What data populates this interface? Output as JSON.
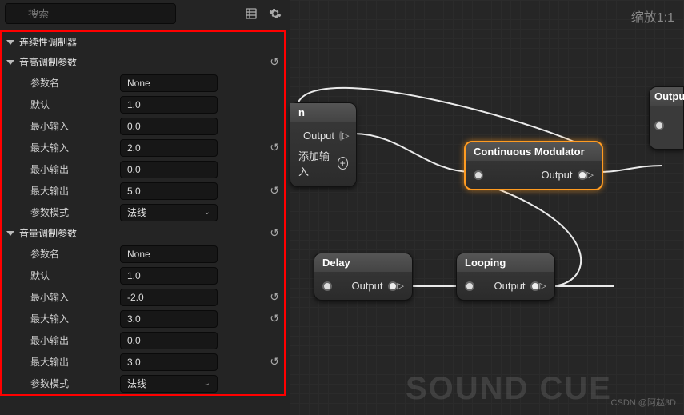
{
  "search": {
    "placeholder": "搜索"
  },
  "zoom_label": "缩放1:1",
  "sections": {
    "root": "连续性调制器",
    "pitch": {
      "title": "音高调制参数",
      "paramName": {
        "label": "参数名",
        "value": "None"
      },
      "default": {
        "label": "默认",
        "value": "1.0"
      },
      "minIn": {
        "label": "最小输入",
        "value": "0.0"
      },
      "maxIn": {
        "label": "最大输入",
        "value": "2.0"
      },
      "minOut": {
        "label": "最小输出",
        "value": "0.0"
      },
      "maxOut": {
        "label": "最大输出",
        "value": "5.0"
      },
      "mode": {
        "label": "参数模式",
        "value": "法线"
      }
    },
    "volume": {
      "title": "音量调制参数",
      "paramName": {
        "label": "参数名",
        "value": "None"
      },
      "default": {
        "label": "默认",
        "value": "1.0"
      },
      "minIn": {
        "label": "最小输入",
        "value": "-2.0"
      },
      "maxIn": {
        "label": "最大输入",
        "value": "3.0"
      },
      "minOut": {
        "label": "最小输出",
        "value": "0.0"
      },
      "maxOut": {
        "label": "最大输出",
        "value": "3.0"
      },
      "mode": {
        "label": "参数模式",
        "value": "法线"
      }
    }
  },
  "nodes": {
    "mixer": {
      "output": "Output",
      "addInput": "添加输入"
    },
    "cm": {
      "title": "Continuous Modulator",
      "output": "Output"
    },
    "delay": {
      "title": "Delay",
      "output": "Output"
    },
    "looping": {
      "title": "Looping",
      "output": "Output"
    },
    "out": {
      "title": "Output"
    }
  },
  "watermark": "SOUND CUE",
  "csdn": "CSDN @阿赵3D"
}
